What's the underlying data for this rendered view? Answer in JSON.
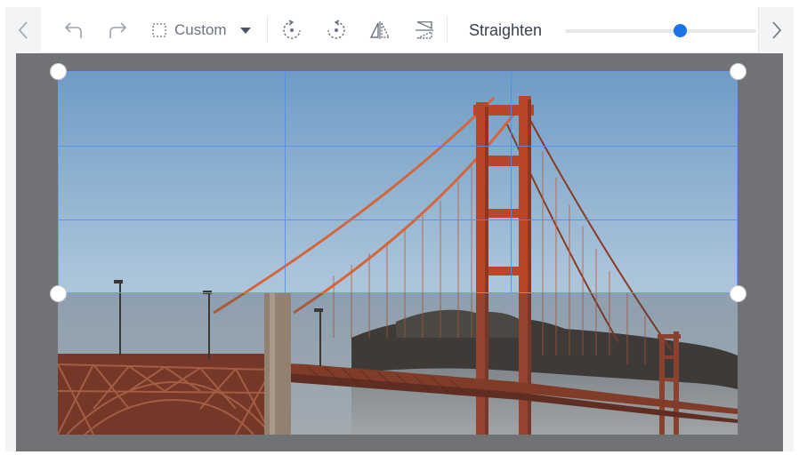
{
  "toolbar": {
    "prev_icon": "chevron-left-icon",
    "undo_icon": "undo-icon",
    "redo_icon": "redo-icon",
    "aspect_icon": "dashed-square-icon",
    "aspect_label": "Custom",
    "aspect_dropdown_icon": "caret-down-icon",
    "rotate_left_icon": "rotate-left-icon",
    "rotate_right_icon": "rotate-right-icon",
    "flip_horizontal_icon": "flip-horizontal-icon",
    "flip_vertical_icon": "flip-vertical-icon",
    "straighten_label": "Straighten",
    "straighten_value": 0.6,
    "next_icon": "chevron-right-icon"
  },
  "colors": {
    "accent": "#1a73e8",
    "grid": "#5b8def",
    "canvas_bg": "#707275",
    "toolbar_bg": "#ffffff"
  }
}
